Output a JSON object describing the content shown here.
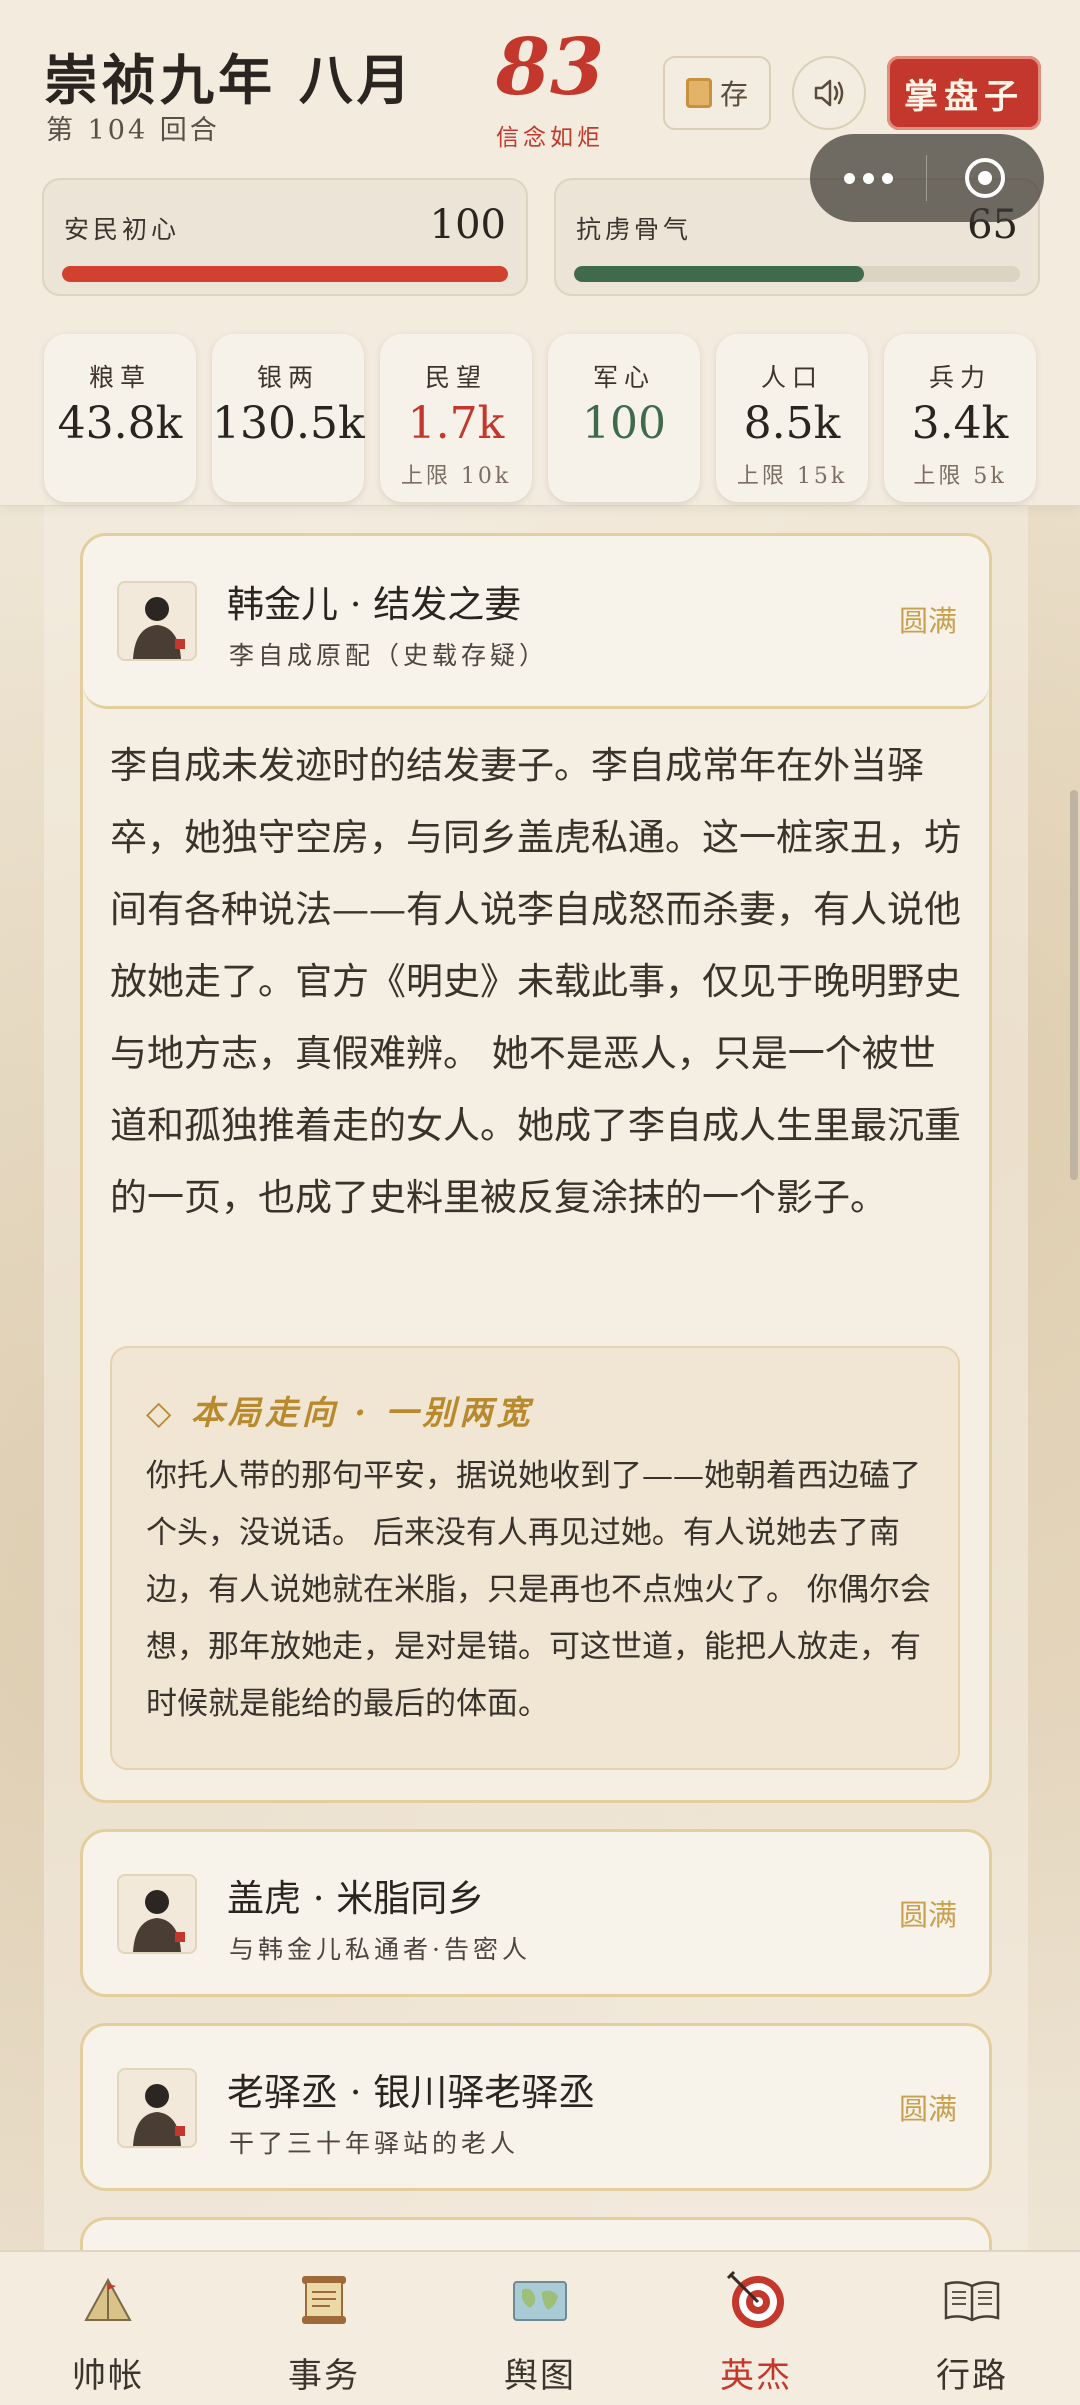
{
  "header": {
    "title": "崇祯九年 八月",
    "round": "第 104 回合",
    "faith_value": "83",
    "faith_label": "信念如炬",
    "save_label": "存",
    "master_label": "掌盘子"
  },
  "meters": [
    {
      "label": "安民初心",
      "value": "100",
      "percent": 100,
      "color": "#d2402f"
    },
    {
      "label": "抗虏骨气",
      "value": "65",
      "percent": 65,
      "color": "#3f6b4c"
    }
  ],
  "stats": [
    {
      "label": "粮草",
      "value": "43.8k",
      "cap": ""
    },
    {
      "label": "银两",
      "value": "130.5k",
      "cap": ""
    },
    {
      "label": "民望",
      "value": "1.7k",
      "cap": "上限 10k"
    },
    {
      "label": "军心",
      "value": "100",
      "cap": ""
    },
    {
      "label": "人口",
      "value": "8.5k",
      "cap": "上限 15k"
    },
    {
      "label": "兵力",
      "value": "3.4k",
      "cap": "上限 5k"
    }
  ],
  "colors": {
    "accent_red": "#c4372c",
    "accent_green": "#3f6b4c",
    "gold": "#c9a04d"
  },
  "characters": [
    {
      "name": "韩金儿 · 结发之妻",
      "subtitle": "李自成原配（史载存疑）",
      "status": "圆满"
    },
    {
      "name": "盖虎 · 米脂同乡",
      "subtitle": "与韩金儿私通者·告密人",
      "status": "圆满"
    },
    {
      "name": "老驿丞 · 银川驿老驿丞",
      "subtitle": "干了三十年驿站的老人",
      "status": "圆满"
    }
  ],
  "detail": {
    "bio": "李自成未发迹时的结发妻子。李自成常年在外当驿卒，她独守空房，与同乡盖虎私通。这一桩家丑，坊间有各种说法——有人说李自成怒而杀妻，有人说他放她走了。官方《明史》未载此事，仅见于晚明野史与地方志，真假难辨。 她不是恶人，只是一个被世道和孤独推着走的女人。她成了李自成人生里最沉重的一页，也成了史料里被反复涂抹的一个影子。",
    "fate_title": "◇ 本局走向 · 一别两宽",
    "fate_text": "你托人带的那句平安，据说她收到了——她朝着西边磕了个头，没说话。 后来没有人再见过她。有人说她去了南边，有人说她就在米脂，只是再也不点烛火了。 你偶尔会想，那年放她走，是对是错。可这世道，能把人放走，有时候就是能给的最后的体面。"
  },
  "tabs": [
    {
      "label": "帅帐",
      "icon": "tent-icon"
    },
    {
      "label": "事务",
      "icon": "scroll-icon"
    },
    {
      "label": "舆图",
      "icon": "map-icon"
    },
    {
      "label": "英杰",
      "icon": "target-icon",
      "active": true
    },
    {
      "label": "行路",
      "icon": "book-icon"
    }
  ]
}
